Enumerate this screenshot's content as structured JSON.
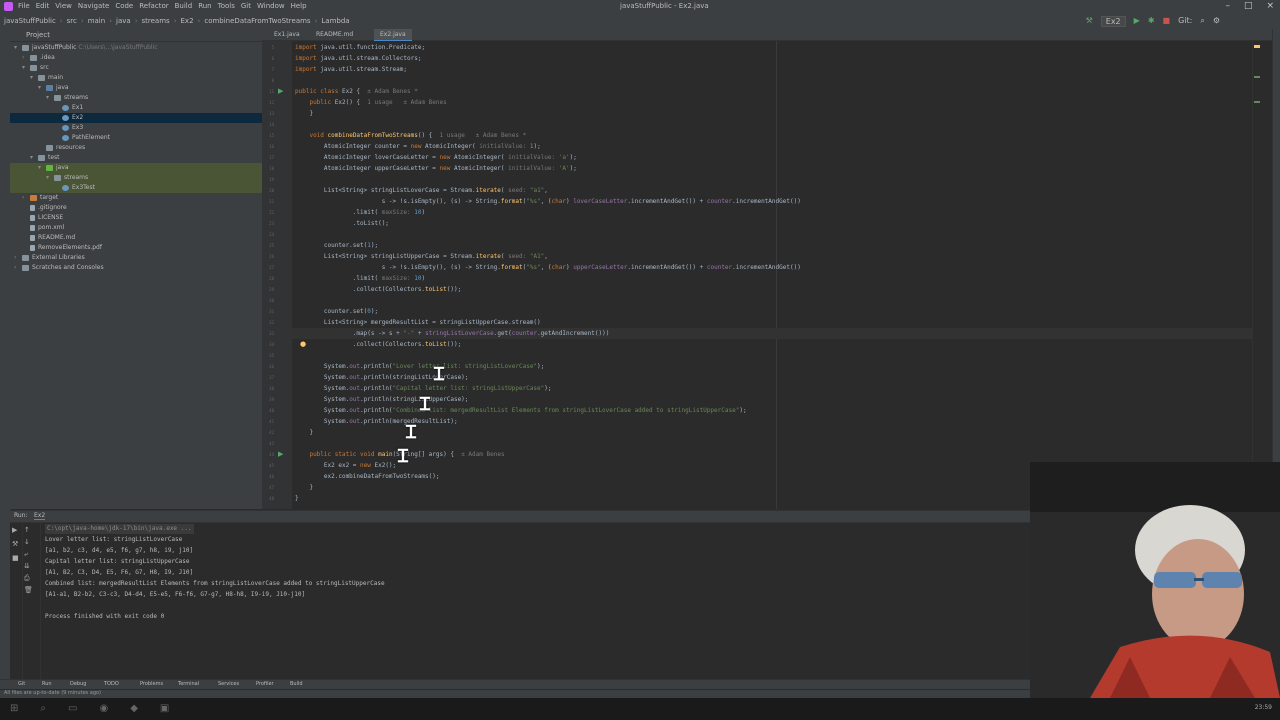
{
  "window": {
    "title": "javaStuffPublic - Ex2.java",
    "menu": [
      "File",
      "Edit",
      "View",
      "Navigate",
      "Code",
      "Refactor",
      "Build",
      "Run",
      "Tools",
      "Git",
      "Window",
      "Help"
    ]
  },
  "navbar": {
    "crumbs": [
      "javaStuffPublic",
      "src",
      "main",
      "java",
      "streams",
      "Ex2",
      "combineDataFromTwoStreams",
      "Lambda"
    ],
    "run_config": "Ex2",
    "git_label": "Git:"
  },
  "project_panel": {
    "title": "Project",
    "items": [
      {
        "label": "javaStuffPublic",
        "hint": "C:\\Users\\...\\javaStuffPublic",
        "indent": 0,
        "icon": "folder",
        "arrow": "▾"
      },
      {
        "label": ".idea",
        "indent": 1,
        "icon": "folder",
        "arrow": "›"
      },
      {
        "label": "src",
        "indent": 1,
        "icon": "folder",
        "arrow": "▾"
      },
      {
        "label": "main",
        "indent": 2,
        "icon": "folder",
        "arrow": "▾"
      },
      {
        "label": "java",
        "indent": 3,
        "icon": "src",
        "arrow": "▾"
      },
      {
        "label": "streams",
        "indent": 4,
        "icon": "folder",
        "arrow": "▾"
      },
      {
        "label": "Ex1",
        "indent": 5,
        "icon": "java",
        "arrow": ""
      },
      {
        "label": "Ex2",
        "indent": 5,
        "icon": "java",
        "arrow": "",
        "state": "selected"
      },
      {
        "label": "Ex3",
        "indent": 5,
        "icon": "java",
        "arrow": ""
      },
      {
        "label": "PathElement",
        "indent": 5,
        "icon": "java",
        "arrow": ""
      },
      {
        "label": "resources",
        "indent": 3,
        "icon": "folder",
        "arrow": ""
      },
      {
        "label": "test",
        "indent": 2,
        "icon": "folder",
        "arrow": "▾"
      },
      {
        "label": "java",
        "indent": 3,
        "icon": "test",
        "arrow": "▾",
        "state": "highlight"
      },
      {
        "label": "streams",
        "indent": 4,
        "icon": "folder",
        "arrow": "▾",
        "state": "highlight"
      },
      {
        "label": "Ex3Test",
        "indent": 5,
        "icon": "java",
        "arrow": "",
        "state": "highlight"
      },
      {
        "label": "target",
        "indent": 1,
        "icon": "target",
        "arrow": "›"
      },
      {
        "label": ".gitignore",
        "indent": 1,
        "icon": "file",
        "arrow": ""
      },
      {
        "label": "LICENSE",
        "indent": 1,
        "icon": "file",
        "arrow": ""
      },
      {
        "label": "pom.xml",
        "indent": 1,
        "icon": "file",
        "arrow": ""
      },
      {
        "label": "README.md",
        "indent": 1,
        "icon": "file",
        "arrow": ""
      },
      {
        "label": "RemoveElements.pdf",
        "indent": 1,
        "icon": "file",
        "arrow": ""
      },
      {
        "label": "External Libraries",
        "indent": 0,
        "icon": "folder",
        "arrow": "›"
      },
      {
        "label": "Scratches and Consoles",
        "indent": 0,
        "icon": "folder",
        "arrow": "›"
      }
    ]
  },
  "editor_tabs": [
    "Ex1.java",
    "README.md",
    "Ex2.java"
  ],
  "code_lines": [
    {
      "n": "5",
      "html": "<span class=\"kw\">import</span> java.util.function.Predicate;"
    },
    {
      "n": "6",
      "html": "<span class=\"kw\">import</span> java.util.stream.Collectors;"
    },
    {
      "n": "7",
      "html": "<span class=\"kw\">import</span> java.util.stream.Stream;"
    },
    {
      "n": "8",
      "html": ""
    },
    {
      "n": "11",
      "html": "<span class=\"kw\">public class</span> Ex2 {  <span class=\"hint\">± Adam Benes *</span>"
    },
    {
      "n": "12",
      "html": "    <span class=\"kw\">public</span> Ex2() {  <span class=\"hint\">1 usage   ± Adam Benes</span>"
    },
    {
      "n": "13",
      "html": "    }"
    },
    {
      "n": "14",
      "html": ""
    },
    {
      "n": "15",
      "html": "    <span class=\"kw\">void</span> <span class=\"fn\">combineDataFromTwoStreams</span>() {  <span class=\"hint\">1 usage   ± Adam Benes *</span>"
    },
    {
      "n": "16",
      "html": "        AtomicInteger counter = <span class=\"kw\">new</span> AtomicInteger( <span class=\"hint\">initialValue:</span> <span class=\"num\">1</span>);"
    },
    {
      "n": "17",
      "html": "        AtomicInteger loverCaseLetter = <span class=\"kw\">new</span> AtomicInteger( <span class=\"hint\">initialValue:</span> <span class=\"str\">'a'</span>);"
    },
    {
      "n": "18",
      "html": "        AtomicInteger upperCaseLetter = <span class=\"kw\">new</span> AtomicInteger( <span class=\"hint\">initialValue:</span> <span class=\"str\">'A'</span>);"
    },
    {
      "n": "19",
      "html": ""
    },
    {
      "n": "20",
      "html": "        List&lt;String&gt; stringListLoverCase = Stream.<span class=\"fn\">iterate</span>( <span class=\"hint\">seed:</span> <span class=\"str\">\"a1\"</span>,"
    },
    {
      "n": "21",
      "html": "                        s -&gt; !s.isEmpty(), (s) -&gt; String.<span class=\"fn\">format</span>(<span class=\"str\">\"%s\"</span>, (<span class=\"kw\">char</span>) <span class=\"fld\">loverCaseLetter</span>.incrementAndGet()) + <span class=\"fld\">counter</span>.incrementAndGet())"
    },
    {
      "n": "22",
      "html": "                .limit( <span class=\"hint\">maxSize:</span> <span class=\"num\">10</span>)"
    },
    {
      "n": "23",
      "html": "                .toList();"
    },
    {
      "n": "24",
      "html": ""
    },
    {
      "n": "25",
      "html": "        counter.set(<span class=\"num\">1</span>);"
    },
    {
      "n": "26",
      "html": "        List&lt;String&gt; stringListUpperCase = Stream.<span class=\"fn\">iterate</span>( <span class=\"hint\">seed:</span> <span class=\"str\">\"A1\"</span>,"
    },
    {
      "n": "27",
      "html": "                        s -&gt; !s.isEmpty(), (s) -&gt; String.<span class=\"fn\">format</span>(<span class=\"str\">\"%s\"</span>, (<span class=\"kw\">char</span>) <span class=\"fld\">upperCaseLetter</span>.incrementAndGet()) + <span class=\"fld\">counter</span>.incrementAndGet())"
    },
    {
      "n": "28",
      "html": "                .limit( <span class=\"hint\">maxSize:</span> <span class=\"num\">10</span>)"
    },
    {
      "n": "29",
      "html": "                .collect(Collectors.<span class=\"fn\">toList</span>());"
    },
    {
      "n": "30",
      "html": ""
    },
    {
      "n": "31",
      "html": "        counter.set(<span class=\"num\">0</span>);"
    },
    {
      "n": "32",
      "html": "        List&lt;String&gt; mergedResultList = stringListUpperCase.stream()"
    },
    {
      "n": "33",
      "html": "                .map(s -&gt; s + <span class=\"str\">\"-\"</span> + <span class=\"fld\">stringListLoverCase</span>.get(<span class=\"fld\">counter</span>.getAndIncrement()))"
    },
    {
      "n": "34",
      "html": "                .collect(Collectors.<span class=\"fn\">toList</span>());"
    },
    {
      "n": "35",
      "html": ""
    },
    {
      "n": "36",
      "html": "        System.<span class=\"fld\">out</span>.println(<span class=\"str\">\"Lover letter list: stringListLoverCase\"</span>);"
    },
    {
      "n": "37",
      "html": "        System.<span class=\"fld\">out</span>.println(stringListLoverCase);"
    },
    {
      "n": "38",
      "html": "        System.<span class=\"fld\">out</span>.println(<span class=\"str\">\"Capital letter list: stringListUpperCase\"</span>);"
    },
    {
      "n": "39",
      "html": "        System.<span class=\"fld\">out</span>.println(stringListUpperCase);"
    },
    {
      "n": "40",
      "html": "        System.<span class=\"fld\">out</span>.println(<span class=\"str\">\"Combined list: mergedResultList Elements from stringListLoverCase added to stringListUpperCase\"</span>);"
    },
    {
      "n": "41",
      "html": "        System.<span class=\"fld\">out</span>.println(mergedResultList);"
    },
    {
      "n": "42",
      "html": "    }"
    },
    {
      "n": "43",
      "html": ""
    },
    {
      "n": "44",
      "html": "    <span class=\"kw\">public static void</span> <span class=\"fn\">main</span>(String[] args) {  <span class=\"hint\">± Adam Benes</span>"
    },
    {
      "n": "45",
      "html": "        Ex2 ex2 = <span class=\"kw\">new</span> Ex2();"
    },
    {
      "n": "46",
      "html": "        ex2.combineDataFromTwoStreams();"
    },
    {
      "n": "47",
      "html": "    }"
    },
    {
      "n": "48",
      "html": "}"
    }
  ],
  "run_panel": {
    "tab_label": "Run:",
    "config": "Ex2",
    "output": [
      {
        "text": "C:\\opt\\java-home\\jdk-17\\bin\\java.exe ...",
        "dim": true
      },
      {
        "text": "Lover letter list: stringListLoverCase"
      },
      {
        "text": "[a1, b2, c3, d4, e5, f6, g7, h8, i9, j10]"
      },
      {
        "text": "Capital letter list: stringListUpperCase"
      },
      {
        "text": "[A1, B2, C3, D4, E5, F6, G7, H8, I9, J10]"
      },
      {
        "text": "Combined list: mergedResultList Elements from stringListLoverCase added to stringListUpperCase"
      },
      {
        "text": "[A1-a1, B2-b2, C3-c3, D4-d4, E5-e5, F6-f6, G7-g7, H8-h8, I9-i9, J10-j10]"
      },
      {
        "text": ""
      },
      {
        "text": "Process finished with exit code 0"
      }
    ]
  },
  "tool_windows": [
    "Git",
    "Run",
    "Debug",
    "TODO",
    "Problems",
    "Terminal",
    "Services",
    "Profiler",
    "Build"
  ],
  "status": "All files are up-to-date (9 minutes ago)",
  "clock": "23:59"
}
